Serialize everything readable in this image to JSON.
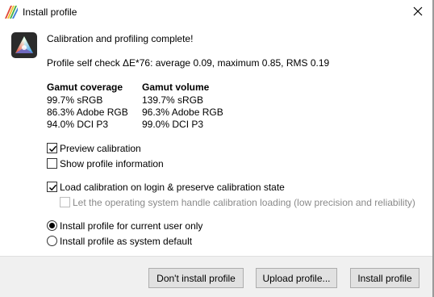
{
  "window": {
    "title": "Install profile"
  },
  "message": {
    "heading": "Calibration and profiling complete!",
    "self_check": "Profile self check ΔE*76: average 0.09, maximum 0.85, RMS 0.19"
  },
  "gamut": {
    "coverage_header": "Gamut coverage",
    "coverage": [
      "99.7% sRGB",
      "86.3% Adobe RGB",
      "94.0% DCI P3"
    ],
    "volume_header": "Gamut volume",
    "volume": [
      "139.7% sRGB",
      "96.3% Adobe RGB",
      "99.0% DCI P3"
    ]
  },
  "options": {
    "preview_calibration": {
      "label": "Preview calibration",
      "checked": true
    },
    "show_profile_info": {
      "label": "Show profile information",
      "checked": false
    },
    "load_calibration": {
      "label": "Load calibration on login & preserve calibration state",
      "checked": true
    },
    "os_handle": {
      "label": "Let the operating system handle calibration loading (low precision and reliability)",
      "checked": false,
      "disabled": true
    }
  },
  "install_scope": {
    "current_user": {
      "label": "Install profile for current user only",
      "selected": true
    },
    "system_default": {
      "label": "Install profile as system default",
      "selected": false
    }
  },
  "buttons": {
    "dont_install": "Don't install profile",
    "upload": "Upload profile...",
    "install": "Install profile"
  },
  "icons": {
    "window_icon": "displaycal-icon",
    "logo": "displaycal-logo-icon",
    "close": "close-icon"
  }
}
